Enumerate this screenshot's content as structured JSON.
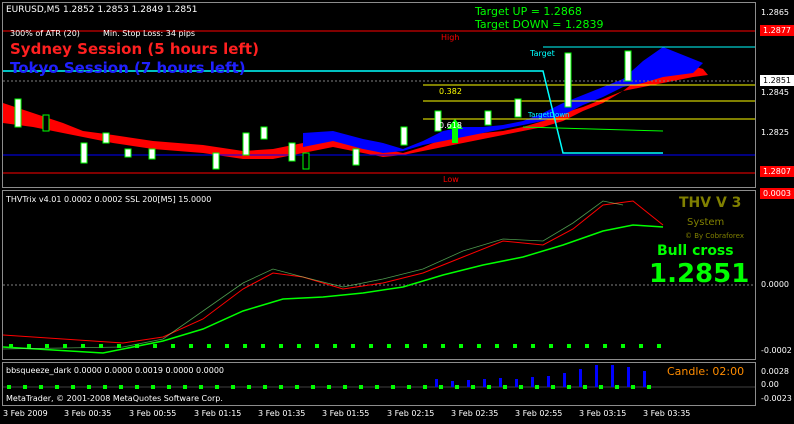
{
  "main": {
    "symbol": "EURUSD,M5  1.2852 1.2853 1.2849 1.2851",
    "atr_text": "300% of ATR (20)",
    "stop_text": "Min. Stop Loss:  34 pips",
    "sydney": "Sydney Session (5 hours left)",
    "tokyo": "Tokyo Session (7 hours left)",
    "target_up": "Target UP      = 1.2868",
    "target_down": "Target DOWN = 1.2839",
    "high_label": "High",
    "low_label": "Low",
    "target_label": "Target",
    "target_down_label": "TargetDown",
    "fib_382": "0.382",
    "fib_618": "0.618",
    "price_ticks": [
      "1.2865",
      "1.2845",
      "1.2825"
    ],
    "high_price": "1.2877",
    "current_price": "1.2851",
    "low_price": "1.2807",
    "colors": {
      "up_candle": "#ffffff",
      "ribbon_red": "#ff0000",
      "ribbon_blue": "#0000ff",
      "high_line": "#ff0000",
      "target_line": "#00ffff"
    }
  },
  "trix": {
    "title": "THVTrix v4.01 0.0002 0.0002  SSL 200[M5] 15.0000",
    "thv_title": "THV V 3",
    "system": "System",
    "credit": "© By Cobraforex",
    "signal": "Bull cross",
    "signal_price": "1.2851",
    "scale_top": "0.0003",
    "scale_mid": "0.0000",
    "scale_bottom": "-0.0002"
  },
  "squeeze": {
    "title": "bbsqueeze_dark 0.0000 0.0000 0.0019 0.0000 0.0000",
    "candle_timer": "Candle:  02:00",
    "scale_top": "0.0028",
    "scale_mid": "0.00",
    "scale_bottom": "-0.0023",
    "copyright": "MetaTrader, © 2001-2008 MetaQuotes Software Corp."
  },
  "time_axis": [
    "3 Feb 2009",
    "3 Feb 00:35",
    "3 Feb 00:55",
    "3 Feb 01:15",
    "3 Feb 01:35",
    "3 Feb 01:55",
    "3 Feb 02:15",
    "3 Feb 02:35",
    "3 Feb 02:55",
    "3 Feb 03:15",
    "3 Feb 03:35"
  ]
}
